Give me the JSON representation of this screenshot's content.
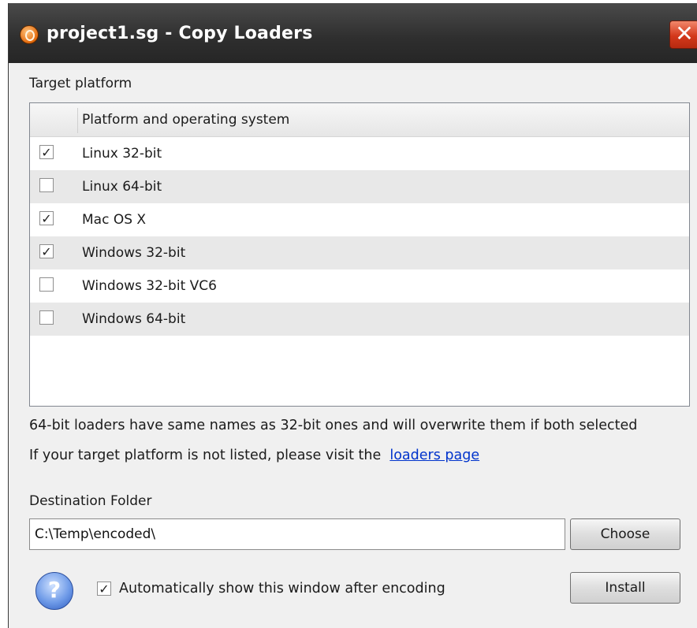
{
  "window": {
    "title": "project1.sg - Copy Loaders",
    "close_glyph": "✕"
  },
  "target": {
    "label": "Target platform",
    "column_header": "Platform and operating system",
    "items": [
      {
        "label": "Linux 32-bit",
        "checked": "✓"
      },
      {
        "label": "Linux 64-bit",
        "checked": ""
      },
      {
        "label": "Mac OS X",
        "checked": "✓"
      },
      {
        "label": "Windows 32-bit",
        "checked": "✓"
      },
      {
        "label": "Windows 32-bit VC6",
        "checked": ""
      },
      {
        "label": "Windows 64-bit",
        "checked": ""
      }
    ]
  },
  "notes": {
    "overwrite": "64-bit loaders have same names as 32-bit ones and will overwrite them if both selected",
    "not_listed": "If your target platform is not listed, please visit the",
    "link_text": "loaders page"
  },
  "destination": {
    "label": "Destination Folder",
    "value": "C:\\Temp\\encoded\\",
    "choose_label": "Choose"
  },
  "footer": {
    "help_glyph": "?",
    "auto_show_checked": "✓",
    "auto_show_label": "Automatically show this window after encoding",
    "install_label": "Install"
  },
  "icons": {
    "app": "app-logo-icon",
    "close": "close-icon",
    "help": "help-icon"
  }
}
